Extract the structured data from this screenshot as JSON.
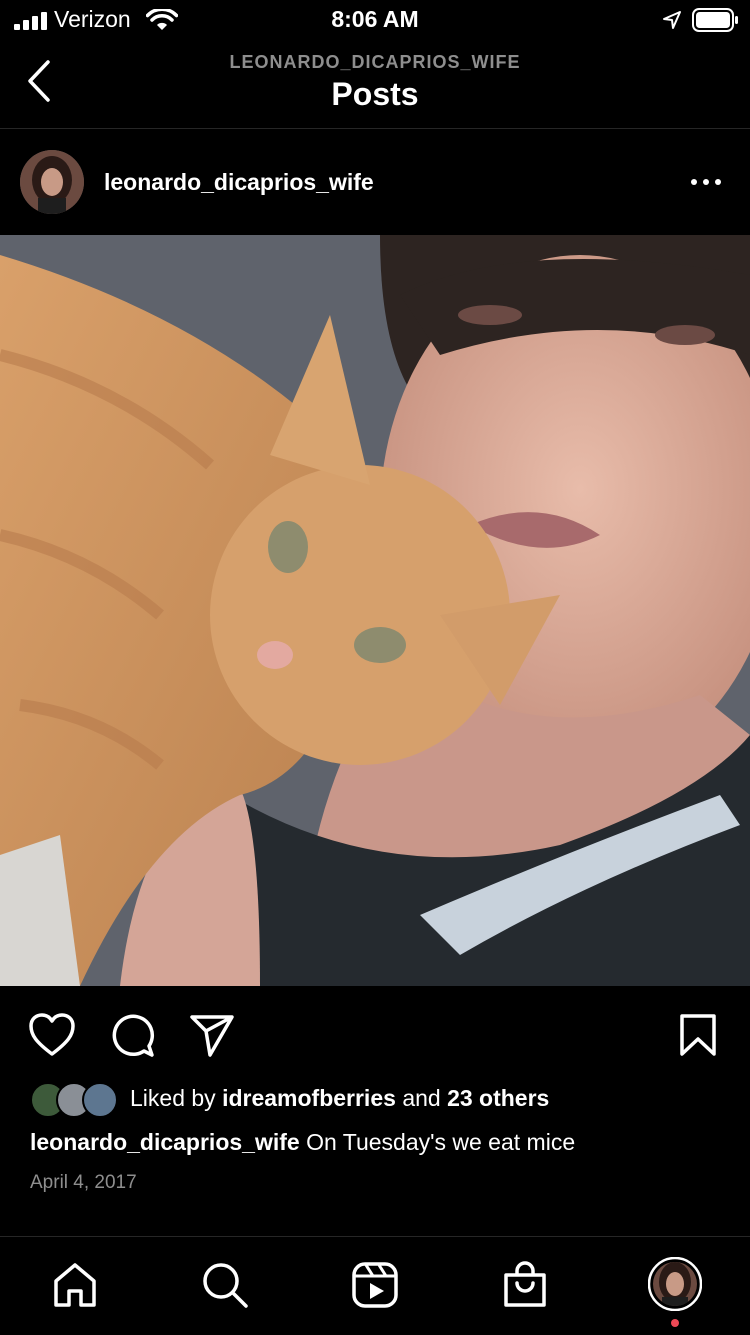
{
  "status_bar": {
    "carrier": "Verizon",
    "time": "8:06 AM"
  },
  "header": {
    "username": "LEONARDO_DICAPRIOS_WIFE",
    "title": "Posts"
  },
  "post": {
    "username": "leonardo_dicaprios_wife",
    "likes": {
      "prefix": "Liked by",
      "user": "idreamofberries",
      "middle": "and",
      "others": "23 others"
    },
    "caption": {
      "user": "leonardo_dicaprios_wife",
      "text": "On Tuesday's we eat mice"
    },
    "date": "April 4, 2017"
  },
  "icons": {
    "header": [
      "back-icon"
    ],
    "actions": [
      "heart-icon",
      "comment-icon",
      "share-icon",
      "bookmark-icon"
    ],
    "nav": [
      "home-icon",
      "search-icon",
      "reels-icon",
      "shop-icon",
      "profile-avatar"
    ]
  },
  "colors": {
    "background": "#000000",
    "secondary_text": "#8e8e8e",
    "notification_dot": "#ed4956"
  }
}
